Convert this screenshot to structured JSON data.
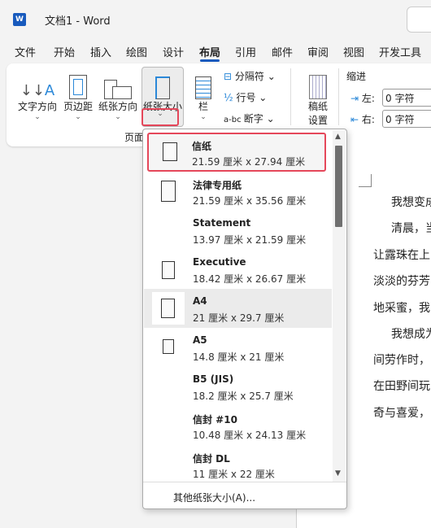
{
  "window": {
    "title": "文档1  -  Word",
    "logo": "W"
  },
  "tabs": [
    {
      "label": "文件"
    },
    {
      "label": "开始"
    },
    {
      "label": "插入"
    },
    {
      "label": "绘图"
    },
    {
      "label": "设计"
    },
    {
      "label": "布局",
      "active": true
    },
    {
      "label": "引用"
    },
    {
      "label": "邮件"
    },
    {
      "label": "审阅"
    },
    {
      "label": "视图"
    },
    {
      "label": "开发工具"
    }
  ],
  "ribbon": {
    "text_direction": "文字方向",
    "margins": "页边距",
    "orientation": "纸张方向",
    "size": "纸张大小",
    "columns": "栏",
    "breaks": "分隔符",
    "line_numbers": "行号",
    "hyphenation": "断字",
    "draft": [
      "稿纸",
      "设置"
    ],
    "group_label": "页面",
    "indent": {
      "label": "缩进",
      "left_label": "左:",
      "left_value": "0 字符",
      "right_label": "右:",
      "right_value": "0 字符"
    }
  },
  "menu": {
    "items": [
      {
        "name": "信纸",
        "size": "21.59 厘米 x 27.94 厘米",
        "icon": "portrait-page",
        "selected": true
      },
      {
        "name": "法律专用纸",
        "size": "21.59 厘米 x 35.56 厘米",
        "icon": "portrait-page"
      },
      {
        "name": "Statement",
        "size": "13.97 厘米 x 21.59 厘米",
        "icon": "none"
      },
      {
        "name": "Executive",
        "size": "18.42 厘米 x 26.67 厘米",
        "icon": "portrait-page"
      },
      {
        "name": "A4",
        "size": "21 厘米 x 29.7 厘米",
        "icon": "portrait-page",
        "hover": true
      },
      {
        "name": "A5",
        "size": "14.8 厘米 x 21 厘米",
        "icon": "portrait-page"
      },
      {
        "name": "B5 (JIS)",
        "size": "18.2 厘米 x 25.7 厘米",
        "icon": "none"
      },
      {
        "name": "信封 #10",
        "size": "10.48 厘米 x 24.13 厘米",
        "icon": "none"
      },
      {
        "name": "信封 DL",
        "size": "11 厘米 x 22 厘米",
        "icon": "none"
      }
    ],
    "more": "其他纸张大小(A)..."
  },
  "document": {
    "lines": [
      "我想变成",
      "清晨，当",
      "让露珠在上",
      "淡淡的芬芳",
      "地采蜜，我",
      "我想成为",
      "间劳作时，",
      "在田野间玩",
      "奇与喜爱，"
    ]
  },
  "colors": {
    "accent": "#185abd",
    "highlight": "#e5475a"
  }
}
